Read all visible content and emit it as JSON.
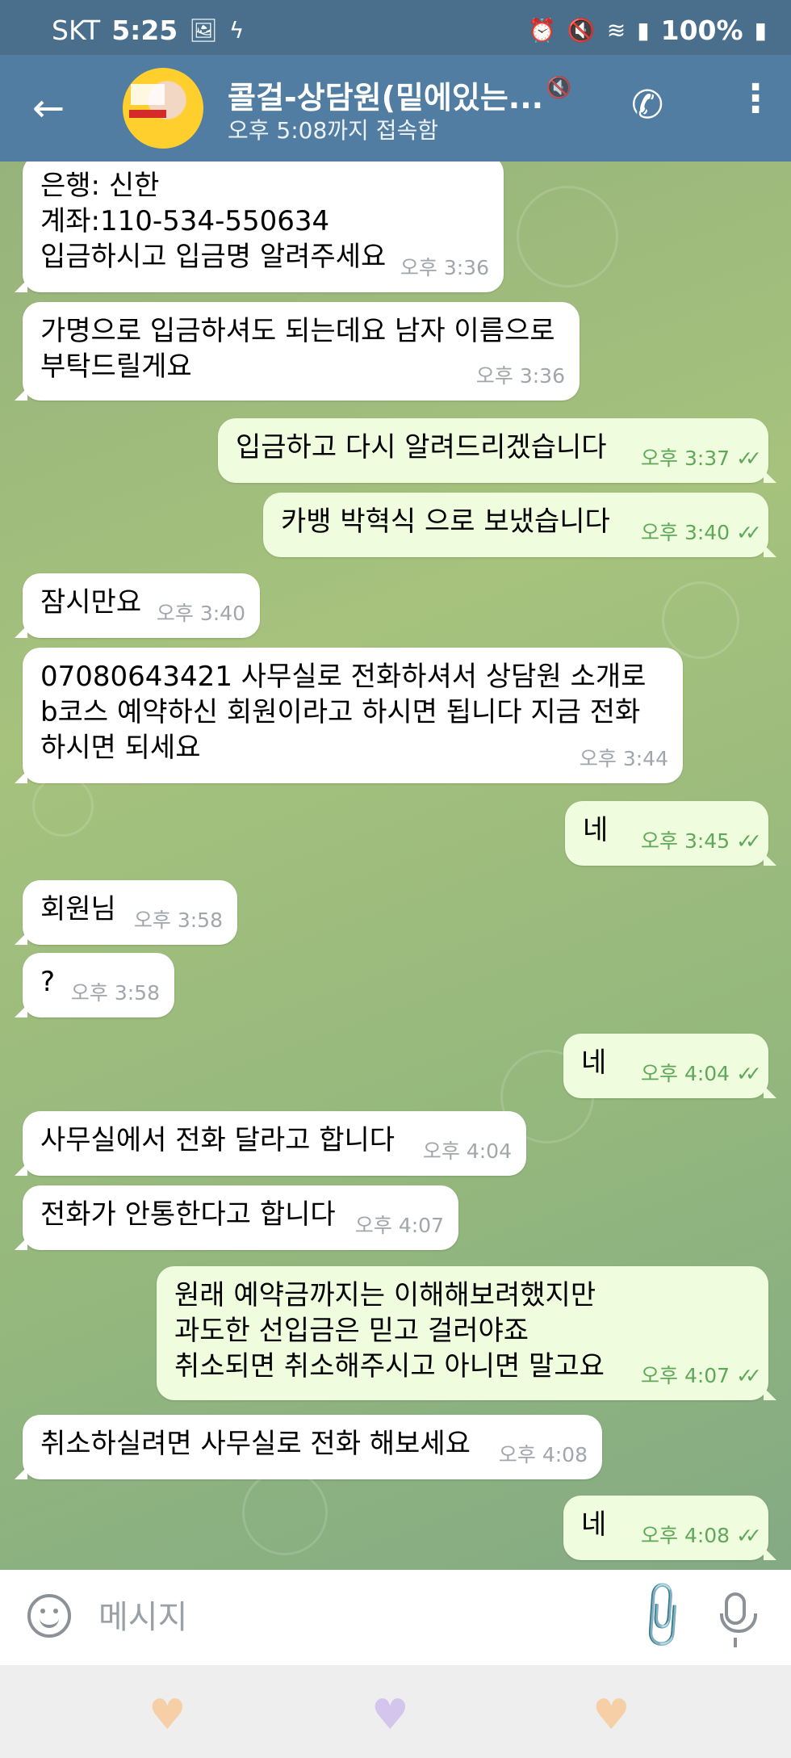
{
  "status_bar": {
    "carrier": "SKT",
    "time": "5:25",
    "battery": "100%",
    "left_icons": [
      "image-icon",
      "nfc-icon"
    ],
    "right_icons": [
      "alarm-icon",
      "mute-icon",
      "wifi-icon",
      "signal-icon",
      "battery-icon"
    ]
  },
  "header": {
    "back_icon": "arrow-left-icon",
    "title": "콜걸-상담원(밑에있는...",
    "muted_icon": "muted-icon",
    "subtitle": "오후 5:08까지 접속함",
    "call_icon": "phone-icon",
    "menu_icon": "more-vert-icon"
  },
  "messages": [
    {
      "dir": "in",
      "text": "은행: 신한\n계좌:110-534-550634\n입금하시고 입금명 알려주세요",
      "time": "오후 3:36"
    },
    {
      "dir": "in",
      "text": "가명으로 입금하셔도 되는데요 남자 이름으로\n부탁드릴게요",
      "time": "오후 3:36"
    },
    {
      "dir": "out",
      "text": "입금하고 다시 알려드리겠습니다",
      "time": "오후 3:37",
      "read": "✓✓"
    },
    {
      "dir": "out",
      "text": "카뱅 박혁식 으로 보냈습니다",
      "time": "오후 3:40",
      "read": "✓✓"
    },
    {
      "dir": "in",
      "text": "잠시만요",
      "time": "오후 3:40"
    },
    {
      "dir": "in",
      "text": "07080643421 사무실로 전화하셔서 상담원 소개로\nb코스 예약하신 회원이라고 하시면 됩니다 지금 전화\n하시면 되세요",
      "time": "오후 3:44"
    },
    {
      "dir": "out",
      "text": "네",
      "time": "오후 3:45",
      "read": "✓✓"
    },
    {
      "dir": "in",
      "text": "회원님",
      "time": "오후 3:58"
    },
    {
      "dir": "in",
      "text": "?",
      "time": "오후 3:58"
    },
    {
      "dir": "out",
      "text": "네",
      "time": "오후 4:04",
      "read": "✓✓"
    },
    {
      "dir": "in",
      "text": "사무실에서 전화 달라고 합니다",
      "time": "오후 4:04"
    },
    {
      "dir": "in",
      "text": "전화가 안통한다고 합니다",
      "time": "오후 4:07"
    },
    {
      "dir": "out",
      "text": "원래 예약금까지는 이해해보려했지만\n과도한 선입금은 믿고 걸러야죠\n취소되면 취소해주시고 아니면 말고요",
      "time": "오후 4:07",
      "read": "✓✓"
    },
    {
      "dir": "in",
      "text": "취소하실려면 사무실로 전화 해보세요",
      "time": "오후 4:08"
    },
    {
      "dir": "out",
      "text": "네",
      "time": "오후 4:08",
      "read": "✓✓"
    }
  ],
  "input": {
    "placeholder": "메시지",
    "emoji_icon": "emoji-icon",
    "attach_icon": "paperclip-icon",
    "mic_icon": "microphone-icon"
  },
  "nav": {
    "icons": [
      "heart-icon",
      "heart-icon",
      "heart-icon"
    ],
    "colors": [
      "#f7cfa6",
      "#d4c5ec",
      "#f7cfa6"
    ]
  },
  "colors": {
    "header": "#517da2",
    "statusbar": "#4a6f8c",
    "incoming": "#ffffff",
    "outgoing": "#effdde",
    "time_out": "#5fa85a"
  }
}
